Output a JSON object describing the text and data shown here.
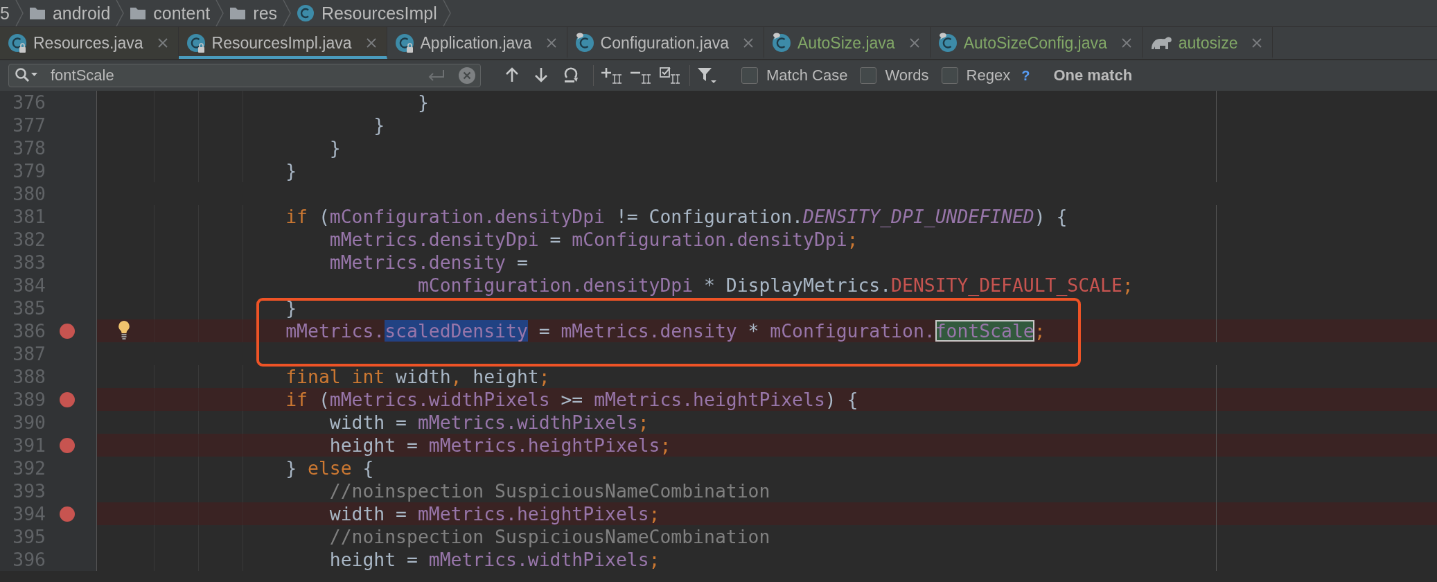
{
  "breadcrumbs": [
    {
      "label": "5",
      "kind": "text"
    },
    {
      "label": "android",
      "kind": "folder"
    },
    {
      "label": "content",
      "kind": "folder"
    },
    {
      "label": "res",
      "kind": "folder"
    },
    {
      "label": "ResourcesImpl",
      "kind": "class"
    }
  ],
  "tabs": [
    {
      "label": "Resources.java",
      "kind": "locked",
      "color": "#bbbbbb",
      "selected": false
    },
    {
      "label": "ResourcesImpl.java",
      "kind": "locked",
      "color": "#bbbbbb",
      "selected": true
    },
    {
      "label": "Application.java",
      "kind": "locked",
      "color": "#bbbbbb",
      "selected": false
    },
    {
      "label": "Configuration.java",
      "kind": "pinned",
      "color": "#bbbbbb",
      "selected": false
    },
    {
      "label": "AutoSize.java",
      "kind": "pinned",
      "color": "#82a867",
      "selected": false
    },
    {
      "label": "AutoSizeConfig.java",
      "kind": "pinned",
      "color": "#82a867",
      "selected": false
    },
    {
      "label": "autosize",
      "kind": "gradle",
      "color": "#82a867",
      "selected": false
    }
  ],
  "find_bar": {
    "value": "fontScale",
    "tools": [
      {
        "kind": "previous"
      },
      {
        "kind": "next"
      },
      {
        "kind": "select-all"
      },
      {
        "kind": "add-occurrence"
      },
      {
        "kind": "remove-occurrence"
      },
      {
        "kind": "select-occurrences"
      },
      {
        "kind": "filter"
      }
    ],
    "options": [
      {
        "label": "Match Case",
        "checked": false
      },
      {
        "label": "Words",
        "checked": false
      },
      {
        "label": "Regex",
        "checked": false
      }
    ],
    "help": "?",
    "status": "One match"
  },
  "editor": {
    "lines": [
      {
        "number": "376",
        "breakpoint": false,
        "bulb": false,
        "boxed": false,
        "tokens": [
          {
            "kind": "plain",
            "text": "                            }"
          }
        ]
      },
      {
        "number": "377",
        "breakpoint": false,
        "bulb": false,
        "boxed": false,
        "tokens": [
          {
            "kind": "plain",
            "text": "                        }"
          }
        ]
      },
      {
        "number": "378",
        "breakpoint": false,
        "bulb": false,
        "boxed": false,
        "tokens": [
          {
            "kind": "plain",
            "text": "                    }"
          }
        ]
      },
      {
        "number": "379",
        "breakpoint": false,
        "bulb": false,
        "boxed": false,
        "tokens": [
          {
            "kind": "plain",
            "text": "                }"
          }
        ]
      },
      {
        "number": "380",
        "breakpoint": false,
        "bulb": false,
        "boxed": false
      },
      {
        "number": "381",
        "breakpoint": false,
        "bulb": false,
        "boxed": false,
        "tokens": [
          {
            "kind": "keyword",
            "text": "                if"
          },
          {
            "kind": "plain",
            "text": " ("
          },
          {
            "kind": "field",
            "text": "mConfiguration.densityDpi"
          },
          {
            "kind": "plain",
            "text": " != Configuration."
          },
          {
            "kind": "static",
            "text": "DENSITY_DPI_UNDEFINED"
          },
          {
            "kind": "plain",
            "text": ") {"
          }
        ]
      },
      {
        "number": "382",
        "breakpoint": false,
        "bulb": false,
        "boxed": false,
        "tokens": [
          {
            "kind": "field",
            "text": "                    mMetrics.densityDpi"
          },
          {
            "kind": "plain",
            "text": " = "
          },
          {
            "kind": "field",
            "text": "mConfiguration.densityDpi"
          },
          {
            "kind": "punct",
            "text": ";"
          }
        ]
      },
      {
        "number": "383",
        "breakpoint": false,
        "bulb": false,
        "boxed": false,
        "tokens": [
          {
            "kind": "field",
            "text": "                    mMetrics.density"
          },
          {
            "kind": "plain",
            "text": " ="
          }
        ]
      },
      {
        "number": "384",
        "breakpoint": false,
        "bulb": false,
        "boxed": false,
        "tokens": [
          {
            "kind": "field",
            "text": "                            mConfiguration.densityDpi"
          },
          {
            "kind": "plain",
            "text": " * DisplayMetrics."
          },
          {
            "kind": "constant",
            "text": "DENSITY_DEFAULT_SCALE"
          },
          {
            "kind": "punct",
            "text": ";"
          }
        ]
      },
      {
        "number": "385",
        "breakpoint": false,
        "bulb": false,
        "boxed": true,
        "tokens": [
          {
            "kind": "plain",
            "text": "                }"
          }
        ]
      },
      {
        "number": "386",
        "breakpoint": true,
        "bulb": true,
        "boxed": true,
        "tokens": [
          {
            "kind": "field",
            "text": "                mMetrics."
          },
          {
            "kind": "selection",
            "text": "scaledDensity"
          },
          {
            "kind": "plain",
            "text": " = "
          },
          {
            "kind": "field",
            "text": "mMetrics.density"
          },
          {
            "kind": "plain",
            "text": " * "
          },
          {
            "kind": "field",
            "text": "mConfiguration."
          },
          {
            "kind": "match",
            "text": "fontScale"
          },
          {
            "kind": "punct",
            "text": ";"
          }
        ]
      },
      {
        "number": "387",
        "breakpoint": false,
        "bulb": false,
        "boxed": true
      },
      {
        "number": "388",
        "breakpoint": false,
        "bulb": false,
        "boxed": false,
        "tokens": [
          {
            "kind": "keyword",
            "text": "                final int"
          },
          {
            "kind": "plain",
            "text": " width"
          },
          {
            "kind": "punct",
            "text": ","
          },
          {
            "kind": "plain",
            "text": " height"
          },
          {
            "kind": "punct",
            "text": ";"
          }
        ]
      },
      {
        "number": "389",
        "breakpoint": true,
        "bulb": false,
        "boxed": false,
        "tokens": [
          {
            "kind": "keyword",
            "text": "                if"
          },
          {
            "kind": "plain",
            "text": " ("
          },
          {
            "kind": "field",
            "text": "mMetrics.widthPixels"
          },
          {
            "kind": "plain",
            "text": " >= "
          },
          {
            "kind": "field",
            "text": "mMetrics.heightPixels"
          },
          {
            "kind": "plain",
            "text": ") {"
          }
        ]
      },
      {
        "number": "390",
        "breakpoint": false,
        "bulb": false,
        "boxed": false,
        "tokens": [
          {
            "kind": "plain",
            "text": "                    width = "
          },
          {
            "kind": "field",
            "text": "mMetrics.widthPixels"
          },
          {
            "kind": "punct",
            "text": ";"
          }
        ]
      },
      {
        "number": "391",
        "breakpoint": true,
        "bulb": false,
        "boxed": false,
        "tokens": [
          {
            "kind": "plain",
            "text": "                    height = "
          },
          {
            "kind": "field",
            "text": "mMetrics.heightPixels"
          },
          {
            "kind": "punct",
            "text": ";"
          }
        ]
      },
      {
        "number": "392",
        "breakpoint": false,
        "bulb": false,
        "boxed": false,
        "tokens": [
          {
            "kind": "plain",
            "text": "                }"
          },
          {
            "kind": "keyword",
            "text": " else"
          },
          {
            "kind": "plain",
            "text": " {"
          }
        ]
      },
      {
        "number": "393",
        "breakpoint": false,
        "bulb": false,
        "boxed": false,
        "tokens": [
          {
            "kind": "comment",
            "text": "                    //noinspection SuspiciousNameCombination"
          }
        ]
      },
      {
        "number": "394",
        "breakpoint": true,
        "bulb": false,
        "boxed": false,
        "tokens": [
          {
            "kind": "plain",
            "text": "                    width = "
          },
          {
            "kind": "field",
            "text": "mMetrics.heightPixels"
          },
          {
            "kind": "punct",
            "text": ";"
          }
        ]
      },
      {
        "number": "395",
        "breakpoint": false,
        "bulb": false,
        "boxed": false,
        "tokens": [
          {
            "kind": "comment",
            "text": "                    //noinspection SuspiciousNameCombination"
          }
        ]
      },
      {
        "number": "396",
        "breakpoint": false,
        "bulb": false,
        "boxed": false,
        "tokens": [
          {
            "kind": "plain",
            "text": "                    height = "
          },
          {
            "kind": "field",
            "text": "mMetrics.widthPixels"
          },
          {
            "kind": "punct",
            "text": ";"
          }
        ]
      }
    ]
  }
}
